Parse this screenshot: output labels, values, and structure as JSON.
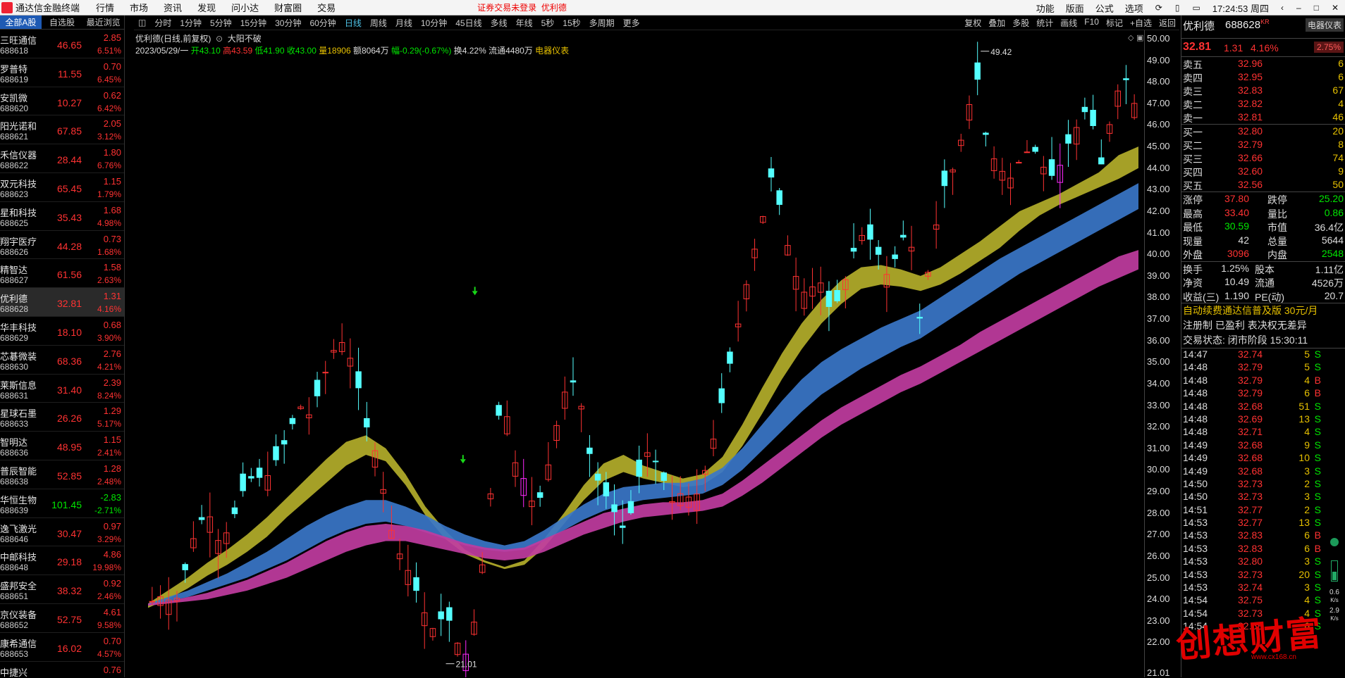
{
  "menubar": {
    "app_title": "通达信金融终端",
    "items": [
      "行情",
      "市场",
      "资讯",
      "发现",
      "问小达",
      "财富圈",
      "交易"
    ],
    "notice": "证券交易未登录",
    "notice_stock": "优利德",
    "right_items": [
      "功能",
      "版面",
      "公式",
      "选项"
    ],
    "clock": "17:24:53 周四"
  },
  "left": {
    "tabs": [
      "全部A股",
      "自选股",
      "最近浏览"
    ],
    "stocks": [
      {
        "name": "三旺通信",
        "code": "688618",
        "price": "46.65",
        "change": "2.85",
        "pct": "6.51%",
        "dir": "up"
      },
      {
        "name": "罗普特",
        "code": "688619",
        "price": "11.55",
        "change": "0.70",
        "pct": "6.45%",
        "dir": "up"
      },
      {
        "name": "安凯微",
        "code": "688620",
        "price": "10.27",
        "change": "0.62",
        "pct": "6.42%",
        "dir": "up"
      },
      {
        "name": "阳光诺和",
        "code": "688621",
        "price": "67.85",
        "change": "2.05",
        "pct": "3.12%",
        "dir": "up"
      },
      {
        "name": "禾信仪器",
        "code": "688622",
        "price": "28.44",
        "change": "1.80",
        "pct": "6.76%",
        "dir": "up"
      },
      {
        "name": "双元科技",
        "code": "688623",
        "price": "65.45",
        "change": "1.15",
        "pct": "1.79%",
        "dir": "up"
      },
      {
        "name": "星和科技",
        "code": "688625",
        "price": "35.43",
        "change": "1.68",
        "pct": "4.98%",
        "dir": "up"
      },
      {
        "name": "翔宇医疗",
        "code": "688626",
        "price": "44.28",
        "change": "0.73",
        "pct": "1.68%",
        "dir": "up"
      },
      {
        "name": "精智达",
        "code": "688627",
        "price": "61.56",
        "change": "1.58",
        "pct": "2.63%",
        "dir": "up"
      },
      {
        "name": "优利德",
        "code": "688628",
        "price": "32.81",
        "change": "1.31",
        "pct": "4.16%",
        "dir": "up",
        "sel": true
      },
      {
        "name": "华丰科技",
        "code": "688629",
        "price": "18.10",
        "change": "0.68",
        "pct": "3.90%",
        "dir": "up"
      },
      {
        "name": "芯碁微装",
        "code": "688630",
        "price": "68.36",
        "change": "2.76",
        "pct": "4.21%",
        "dir": "up"
      },
      {
        "name": "莱斯信息",
        "code": "688631",
        "price": "31.40",
        "change": "2.39",
        "pct": "8.24%",
        "dir": "up"
      },
      {
        "name": "星球石墨",
        "code": "688633",
        "price": "26.26",
        "change": "1.29",
        "pct": "5.17%",
        "dir": "up"
      },
      {
        "name": "智明达",
        "code": "688636",
        "price": "48.95",
        "change": "1.15",
        "pct": "2.41%",
        "dir": "up"
      },
      {
        "name": "普辰智能",
        "code": "688638",
        "price": "52.85",
        "change": "1.28",
        "pct": "2.48%",
        "dir": "up"
      },
      {
        "name": "华恒生物",
        "code": "688639",
        "price": "101.45",
        "change": "-2.83",
        "pct": "-2.71%",
        "dir": "dn"
      },
      {
        "name": "逸飞激光",
        "code": "688646",
        "price": "30.47",
        "change": "0.97",
        "pct": "3.29%",
        "dir": "up"
      },
      {
        "name": "中邮科技",
        "code": "688648",
        "price": "29.18",
        "change": "4.86",
        "pct": "19.98%",
        "dir": "up"
      },
      {
        "name": "盛邦安全",
        "code": "688651",
        "price": "38.32",
        "change": "0.92",
        "pct": "2.46%",
        "dir": "up"
      },
      {
        "name": "京仪装备",
        "code": "688652",
        "price": "52.75",
        "change": "4.61",
        "pct": "9.58%",
        "dir": "up"
      },
      {
        "name": "康希通信",
        "code": "688653",
        "price": "16.02",
        "change": "0.70",
        "pct": "4.57%",
        "dir": "up"
      },
      {
        "name": "中捷兴",
        "code": "",
        "price": "",
        "change": "0.76",
        "pct": "",
        "dir": "up"
      }
    ]
  },
  "timeframes": {
    "items": [
      "分时",
      "1分钟",
      "5分钟",
      "15分钟",
      "30分钟",
      "60分钟",
      "日线",
      "周线",
      "月线",
      "10分钟",
      "45日线",
      "多线",
      "年线",
      "5秒",
      "15秒",
      "多周期",
      "更多"
    ],
    "active": "日线",
    "right": [
      "复权",
      "叠加",
      "多股",
      "统计",
      "画线",
      "F10",
      "标记",
      "+自选",
      "返回"
    ]
  },
  "chart_head": {
    "title": "优利德(日线,前复权)",
    "indicator": "大阳不破"
  },
  "info": {
    "date": "2023/05/29/一",
    "open": "开43.10",
    "high": "高43.59",
    "low": "低41.90",
    "close": "收43.00",
    "vol": "量18906",
    "amt": "额8064万",
    "rng": "幅-0.29(-0.67%)",
    "turn": "换4.22%",
    "float": "流通4480万",
    "sector": "电器仪表"
  },
  "yaxis": {
    "ticks": [
      "50.00",
      "49.00",
      "48.00",
      "47.00",
      "46.00",
      "45.00",
      "44.00",
      "43.00",
      "42.00",
      "41.00",
      "40.00",
      "39.00",
      "38.00",
      "37.00",
      "36.00",
      "35.00",
      "34.00",
      "33.00",
      "32.00",
      "31.00",
      "30.00",
      "29.00",
      "28.00",
      "27.00",
      "26.00",
      "25.00",
      "24.00",
      "23.00",
      "22.00"
    ],
    "bottom": "21.01",
    "hi_label": "49.42",
    "lo_label": "21.01"
  },
  "right": {
    "name": "优利德",
    "code": "688628",
    "code_tag": "KR",
    "tag": "电器仪表",
    "price": "32.81",
    "change": "1.31",
    "pct": "4.16%",
    "pct2": "2.75%",
    "asks": [
      {
        "l": "卖五",
        "p": "32.96",
        "v": "6"
      },
      {
        "l": "卖四",
        "p": "32.95",
        "v": "6"
      },
      {
        "l": "卖三",
        "p": "32.83",
        "v": "67"
      },
      {
        "l": "卖二",
        "p": "32.82",
        "v": "4"
      },
      {
        "l": "卖一",
        "p": "32.81",
        "v": "46"
      }
    ],
    "bids": [
      {
        "l": "买一",
        "p": "32.80",
        "v": "20"
      },
      {
        "l": "买二",
        "p": "32.79",
        "v": "8"
      },
      {
        "l": "买三",
        "p": "32.66",
        "v": "74"
      },
      {
        "l": "买四",
        "p": "32.60",
        "v": "9"
      },
      {
        "l": "买五",
        "p": "32.56",
        "v": "50"
      }
    ],
    "stats": [
      {
        "a": "涨停",
        "av": "37.80",
        "ac": "up",
        "b": "跌停",
        "bv": "25.20",
        "bc": "dn"
      },
      {
        "a": "最高",
        "av": "33.40",
        "ac": "up",
        "b": "量比",
        "bv": "0.86",
        "bc": "dn"
      },
      {
        "a": "最低",
        "av": "30.59",
        "ac": "dn",
        "b": "市值",
        "bv": "36.4亿",
        "bc": "wt"
      },
      {
        "a": "现量",
        "av": "42",
        "ac": "wt",
        "b": "总量",
        "bv": "5644",
        "bc": "wt"
      },
      {
        "a": "外盘",
        "av": "3096",
        "ac": "up",
        "b": "内盘",
        "bv": "2548",
        "bc": "dn"
      }
    ],
    "stats2": [
      {
        "a": "换手",
        "av": "1.25%",
        "b": "股本",
        "bv": "1.11亿"
      },
      {
        "a": "净资",
        "av": "10.49",
        "b": "流通",
        "bv": "4526万"
      },
      {
        "a": "收益(三)",
        "av": "1.190",
        "b": "PE(动)",
        "bv": "20.7"
      }
    ],
    "notes": [
      "自动续费通达信普及版 30元/月",
      "注册制 已盈利 表决权无差异",
      "交易状态: 闭市阶段 15:30:11"
    ],
    "ticks": [
      {
        "t": "14:47",
        "p": "32.74",
        "v": "5",
        "s": "S"
      },
      {
        "t": "14:48",
        "p": "32.79",
        "v": "5",
        "s": "S"
      },
      {
        "t": "14:48",
        "p": "32.79",
        "v": "4",
        "s": "B"
      },
      {
        "t": "14:48",
        "p": "32.79",
        "v": "6",
        "s": "B"
      },
      {
        "t": "14:48",
        "p": "32.68",
        "v": "51",
        "s": "S"
      },
      {
        "t": "14:48",
        "p": "32.69",
        "v": "13",
        "s": "S"
      },
      {
        "t": "14:48",
        "p": "32.71",
        "v": "4",
        "s": "S"
      },
      {
        "t": "14:49",
        "p": "32.68",
        "v": "9",
        "s": "S"
      },
      {
        "t": "14:49",
        "p": "32.68",
        "v": "10",
        "s": "S"
      },
      {
        "t": "14:49",
        "p": "32.68",
        "v": "3",
        "s": "S"
      },
      {
        "t": "14:50",
        "p": "32.73",
        "v": "2",
        "s": "S"
      },
      {
        "t": "14:50",
        "p": "32.73",
        "v": "3",
        "s": "S"
      },
      {
        "t": "14:51",
        "p": "32.77",
        "v": "2",
        "s": "S"
      },
      {
        "t": "14:53",
        "p": "32.77",
        "v": "13",
        "s": "S"
      },
      {
        "t": "14:53",
        "p": "32.83",
        "v": "6",
        "s": "B"
      },
      {
        "t": "14:53",
        "p": "32.83",
        "v": "6",
        "s": "B"
      },
      {
        "t": "14:53",
        "p": "32.80",
        "v": "3",
        "s": "S"
      },
      {
        "t": "14:53",
        "p": "32.73",
        "v": "20",
        "s": "S"
      },
      {
        "t": "14:53",
        "p": "32.74",
        "v": "3",
        "s": "S"
      },
      {
        "t": "14:54",
        "p": "32.75",
        "v": "4",
        "s": "S"
      },
      {
        "t": "14:54",
        "p": "32.73",
        "v": "4",
        "s": "S"
      },
      {
        "t": "14:54",
        "p": "32.68",
        "v": "6",
        "s": "S"
      }
    ],
    "speed": {
      "a": "0.6",
      "b": "2.9",
      "unit": "K/s"
    }
  },
  "watermark": {
    "text": "创想财富",
    "url": "www.cx168.cn"
  },
  "chart_data": {
    "type": "candlestick",
    "y_range": [
      21.0,
      50.0
    ],
    "high_mark": 49.42,
    "low_mark": 21.01,
    "indicator": "大阳不破",
    "bands": [
      {
        "name": "yellow",
        "color": "#b3ae2a",
        "upper": [
          23.8,
          24.4,
          25,
          25.7,
          26.3,
          27,
          27.8,
          28.7,
          29.6,
          30.5,
          31.3,
          31.6,
          31,
          29.8,
          28.3,
          27.2,
          26.3,
          25.8,
          25.5,
          25.8,
          26.8,
          28,
          29.3,
          30.3,
          30.7,
          30.2,
          29.9,
          29.6,
          29.8,
          30.6,
          32.1,
          33.8,
          35.4,
          36.8,
          37.9,
          38.8,
          39.4,
          39.5,
          39.3,
          39,
          39.4,
          40,
          40.6,
          41.3,
          42,
          42.4,
          42.8,
          43.3,
          43.8,
          44.6,
          45
        ],
        "lower": [
          23.6,
          24,
          24.5,
          25.1,
          25.6,
          26.2,
          26.9,
          27.8,
          28.6,
          29.4,
          30.2,
          30.7,
          30.4,
          29.3,
          27.9,
          26.8,
          26.1,
          25.7,
          25.4,
          25.6,
          26.4,
          27.5,
          28.6,
          29.5,
          29.9,
          29.6,
          29.4,
          29.2,
          29.3,
          29.9,
          31.1,
          32.6,
          34.2,
          35.6,
          36.8,
          37.7,
          38.4,
          38.6,
          38.5,
          38.3,
          38.6,
          39.1,
          39.7,
          40.3,
          41.1,
          41.8,
          42.3,
          42.7,
          43.1,
          43.5,
          44
        ]
      },
      {
        "name": "blue",
        "color": "#3a76c8",
        "upper": [
          23.8,
          24.1,
          24.4,
          24.8,
          25.2,
          25.7,
          26.2,
          26.8,
          27.4,
          27.9,
          28.3,
          28.6,
          28.6,
          28.3,
          27.9,
          27.4,
          27,
          26.7,
          26.5,
          26.7,
          27.2,
          27.8,
          28.4,
          28.9,
          29.2,
          29.3,
          29.4,
          29.4,
          29.6,
          30.1,
          31,
          32.1,
          33.2,
          34.2,
          35,
          35.6,
          36.1,
          36.6,
          37,
          37.4,
          38,
          38.6,
          39.2,
          39.8,
          40.3,
          40.8,
          41.3,
          41.8,
          42.3,
          42.8,
          43.3
        ],
        "lower": [
          23.7,
          23.9,
          24.1,
          24.4,
          24.7,
          25,
          25.4,
          25.8,
          26.3,
          26.8,
          27.2,
          27.5,
          27.6,
          27.4,
          27.1,
          26.8,
          26.5,
          26.3,
          26.2,
          26.3,
          26.7,
          27.2,
          27.7,
          28.1,
          28.4,
          28.6,
          28.7,
          28.8,
          28.9,
          29.3,
          30,
          30.9,
          31.8,
          32.7,
          33.5,
          34.1,
          34.7,
          35.2,
          35.7,
          36.1,
          36.7,
          37.3,
          37.9,
          38.5,
          39.1,
          39.6,
          40.1,
          40.6,
          41.1,
          41.6,
          42.1
        ]
      },
      {
        "name": "magenta",
        "color": "#c03ca0",
        "upper": [
          23.8,
          23.9,
          24.1,
          24.3,
          24.6,
          24.9,
          25.3,
          25.7,
          26.2,
          26.7,
          27.1,
          27.4,
          27.5,
          27.4,
          27.2,
          26.9,
          26.6,
          26.4,
          26.3,
          26.4,
          26.8,
          27.2,
          27.6,
          28,
          28.2,
          28.4,
          28.5,
          28.5,
          28.6,
          28.9,
          29.5,
          30.2,
          30.9,
          31.6,
          32.3,
          32.9,
          33.4,
          33.9,
          34.4,
          34.8,
          35.3,
          35.8,
          36.4,
          36.9,
          37.4,
          37.9,
          38.4,
          38.9,
          39.4,
          39.9,
          40.2
        ],
        "lower": [
          23.7,
          23.8,
          23.9,
          24,
          24.2,
          24.4,
          24.7,
          25,
          25.4,
          25.8,
          26.2,
          26.5,
          26.7,
          26.7,
          26.5,
          26.3,
          26.1,
          25.9,
          25.8,
          25.9,
          26.2,
          26.6,
          27,
          27.3,
          27.6,
          27.8,
          27.9,
          28,
          28.1,
          28.3,
          28.8,
          29.4,
          30.1,
          30.8,
          31.5,
          32.1,
          32.6,
          33.1,
          33.6,
          34,
          34.5,
          35,
          35.5,
          36,
          36.5,
          37,
          37.5,
          38,
          38.5,
          38.9,
          39.3
        ]
      }
    ]
  }
}
